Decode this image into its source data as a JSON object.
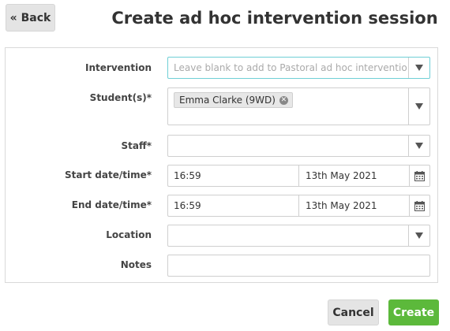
{
  "header": {
    "back_label": "« Back",
    "title": "Create ad hoc intervention session"
  },
  "form": {
    "intervention": {
      "label": "Intervention",
      "placeholder": "Leave blank to add to Pastoral ad hoc interventions"
    },
    "students": {
      "label": "Student(s)*",
      "selected": [
        "Emma Clarke (9WD)"
      ]
    },
    "staff": {
      "label": "Staff*",
      "value": ""
    },
    "start": {
      "label": "Start date/time*",
      "time": "16:59",
      "date": "13th May 2021"
    },
    "end": {
      "label": "End date/time*",
      "time": "16:59",
      "date": "13th May 2021"
    },
    "location": {
      "label": "Location",
      "value": ""
    },
    "notes": {
      "label": "Notes",
      "value": ""
    }
  },
  "actions": {
    "cancel_label": "Cancel",
    "create_label": "Create"
  },
  "colors": {
    "create_button": "#5cb93b",
    "focus_border": "#6fcfd6"
  },
  "icons": {
    "dropdown": "chevron-down-icon",
    "calendar": "calendar-icon",
    "chip_remove": "close-icon"
  }
}
